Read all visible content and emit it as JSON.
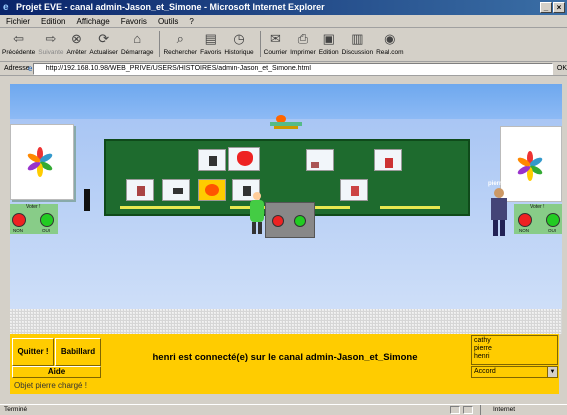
{
  "window": {
    "title": "Projet EVE - canal admin-Jason_et_Simone - Microsoft Internet Explorer"
  },
  "menu": [
    "Fichier",
    "Edition",
    "Affichage",
    "Favoris",
    "Outils",
    "?"
  ],
  "toolbar": [
    {
      "label": "Précédente",
      "icon": "back-arrow-icon",
      "enabled": true
    },
    {
      "label": "Suivante",
      "icon": "forward-arrow-icon",
      "enabled": false
    },
    {
      "label": "Arrêter",
      "icon": "stop-icon",
      "enabled": true
    },
    {
      "label": "Actualiser",
      "icon": "refresh-icon",
      "enabled": true
    },
    {
      "label": "Démarrage",
      "icon": "home-icon",
      "enabled": true
    },
    {
      "label": "Rechercher",
      "icon": "search-icon",
      "enabled": true
    },
    {
      "label": "Favoris",
      "icon": "favorites-icon",
      "enabled": true
    },
    {
      "label": "Historique",
      "icon": "history-icon",
      "enabled": true
    },
    {
      "label": "Courrier",
      "icon": "mail-icon",
      "enabled": true
    },
    {
      "label": "Imprimer",
      "icon": "print-icon",
      "enabled": true
    },
    {
      "label": "Edition",
      "icon": "edit-icon",
      "enabled": true
    },
    {
      "label": "Discussion",
      "icon": "discussion-icon",
      "enabled": true
    },
    {
      "label": "Real.com",
      "icon": "realcom-icon",
      "enabled": true
    }
  ],
  "address": {
    "label": "Adresse",
    "url": "http://192.168.10.98/WEB_PRIVE/USERS/HISTOIRES/admin-Jason_et_Simone.html",
    "go_label": "OK"
  },
  "scene": {
    "avatar_name": "pierre",
    "vote_title": "Voter !",
    "vote_no": "NON",
    "vote_yes": "OUI",
    "colors": {
      "sky": "#7cb0f0",
      "board": "#1e6b2e",
      "floor": "#d6d6d6"
    }
  },
  "controls": {
    "quit_label": "Quitter !",
    "chat_label": "Babillard",
    "help_label": "Aide",
    "status_message": "henri est connecté(e) sur le canal admin-Jason_et_Simone",
    "users": [
      "cathy",
      "pierre",
      "henri"
    ],
    "accord_value": "Accord",
    "loaded_message": "Objet pierre chargé !",
    "panel_color": "#ffcc00"
  },
  "statusbar": {
    "done": "Terminé",
    "zone": "Internet"
  }
}
